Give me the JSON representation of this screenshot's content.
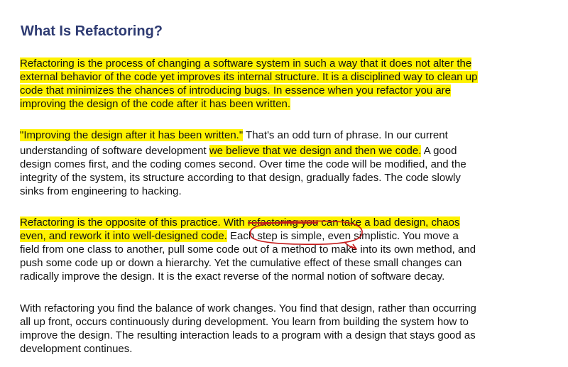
{
  "title": "What Is Refactoring?",
  "paragraphs": [
    {
      "lines": [
        [
          {
            "t": "Refactoring is the process of changing a software system in such a way that it does not alter the",
            "h": true
          }
        ],
        [
          {
            "t": "external behavior of the code yet improves its internal structure. It is a disciplined way to clean up",
            "h": true
          }
        ],
        [
          {
            "t": "code that minimizes the chances of introducing bugs. In essence when you refactor you are",
            "h": true
          }
        ],
        [
          {
            "t": "improving the design of the code after it has been written.",
            "h": true
          }
        ]
      ]
    },
    {
      "lines": [
        [
          {
            "t": "\"Improving the design after it has been written.\"",
            "h": true
          },
          {
            "t": " That's an odd turn of phrase. In our current",
            "h": false
          }
        ],
        [
          {
            "t": "understanding of software development ",
            "h": false
          },
          {
            "t": "we believe that we design and then we code.",
            "h": true
          },
          {
            "t": " A good",
            "h": false
          }
        ],
        [
          {
            "t": "design comes first, and the coding comes second. Over time the code will be modified, and the",
            "h": false
          }
        ],
        [
          {
            "t": "integrity of the system, its structure according to that design, gradually fades. The code slowly",
            "h": false
          }
        ],
        [
          {
            "t": "sinks from engineering to hacking.",
            "h": false
          }
        ]
      ]
    },
    {
      "lines": [
        [
          {
            "t": "Refactoring is the opposite of this practice. With ",
            "h": true
          },
          {
            "t": "refactoring you",
            "h": true,
            "s": true
          },
          {
            "t": " can take a bad design, chaos",
            "h": true
          }
        ],
        [
          {
            "t": "even, and rework it into well-designed code.",
            "h": true
          },
          {
            "t": " ",
            "h": false
          },
          {
            "t": "Each step is simple,",
            "h": false,
            "c": true
          },
          {
            "t": " even simplistic. You move a",
            "h": false
          }
        ],
        [
          {
            "t": "field from one class to another, pull some code out of a method to make into its own method, and",
            "h": false
          }
        ],
        [
          {
            "t": "push some code up or down a hierarchy. Yet the cumulative effect of these small changes can",
            "h": false
          }
        ],
        [
          {
            "t": "radically improve the design. It is the exact reverse of the normal notion of software decay.",
            "h": false
          }
        ]
      ]
    },
    {
      "lines": [
        [
          {
            "t": "With refactoring you find the balance of work changes. You find that design, rather than occurring",
            "h": false
          }
        ],
        [
          {
            "t": "all up front, occurs continuously during development. You learn from building the system how to",
            "h": false
          }
        ],
        [
          {
            "t": "improve the design. The resulting interaction leads to a program with a design that stays good as",
            "h": false
          }
        ],
        [
          {
            "t": "development continues.",
            "h": false
          }
        ]
      ]
    }
  ],
  "colors": {
    "title": "#2e3b72",
    "text": "#111111",
    "highlight": "#fff200",
    "annotation": "#c41a1a"
  }
}
